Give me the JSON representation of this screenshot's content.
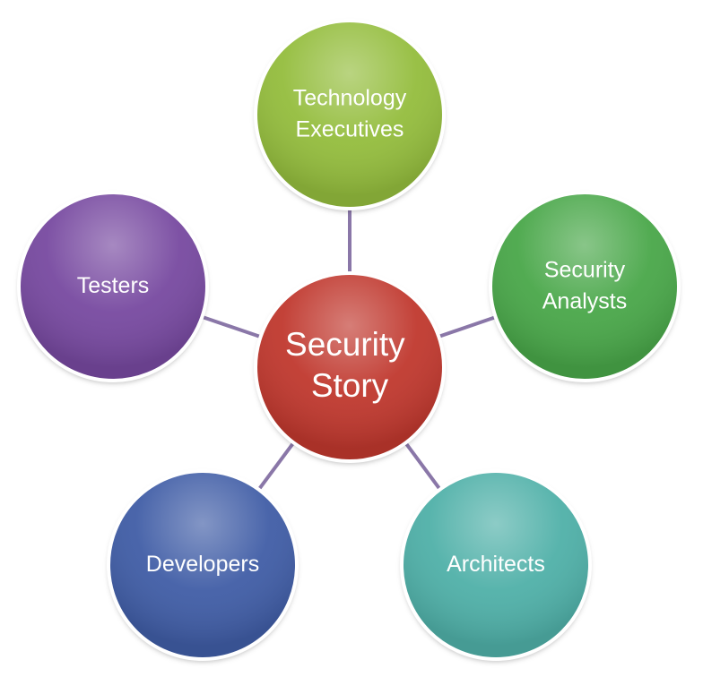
{
  "center": {
    "lines": [
      "Security",
      "Story"
    ],
    "color": "#c0392f"
  },
  "nodes": [
    {
      "id": "technology-executives",
      "lines": [
        "Technology",
        "Executives"
      ],
      "color": "#94bd3c"
    },
    {
      "id": "security-analysts",
      "lines": [
        "Security",
        "Analysts"
      ],
      "color": "#4aa748"
    },
    {
      "id": "architects",
      "lines": [
        "Architects"
      ],
      "color": "#4fb0a8"
    },
    {
      "id": "developers",
      "lines": [
        "Developers"
      ],
      "color": "#3f5da6"
    },
    {
      "id": "testers",
      "lines": [
        "Testers"
      ],
      "color": "#7748a0"
    }
  ],
  "connector_color": "#8a77a8"
}
